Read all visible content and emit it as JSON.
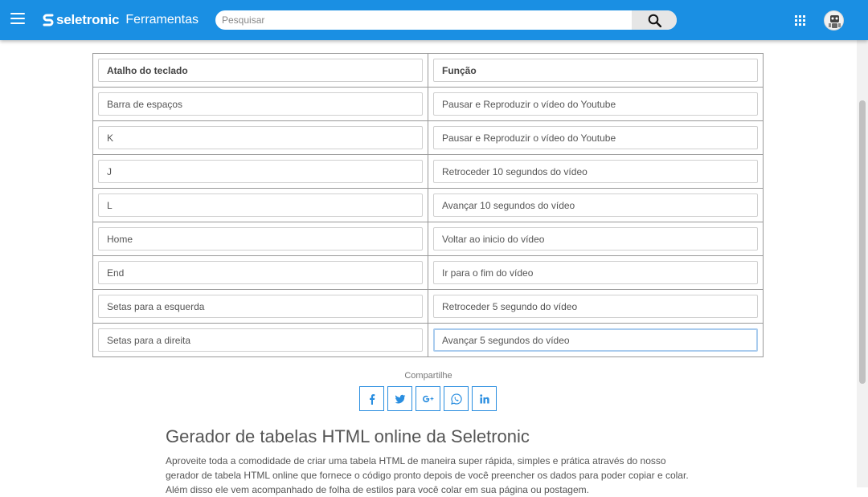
{
  "header": {
    "brand": "seletronic",
    "section": "Ferramentas",
    "search_placeholder": "Pesquisar",
    "accent": "#1a8fe3"
  },
  "table": {
    "headers": [
      "Atalho do teclado",
      "Função"
    ],
    "rows": [
      [
        "Barra de espaços",
        "Pausar e Reproduzir o vídeo do Youtube"
      ],
      [
        "K",
        "Pausar e Reproduzir o vídeo do Youtube"
      ],
      [
        "J",
        "Retroceder 10 segundos do vídeo"
      ],
      [
        "L",
        "Avançar 10 segundos do vídeo"
      ],
      [
        "Home",
        "Voltar ao inicio do vídeo"
      ],
      [
        "End",
        "Ir para o fim do vídeo"
      ],
      [
        "Setas para a esquerda",
        "Retroceder 5 segundo do vídeo"
      ],
      [
        "Setas para a direita",
        "Avançar 5 segundos do vídeo"
      ]
    ]
  },
  "share": {
    "label": "Compartilhe",
    "buttons": [
      "facebook-icon",
      "twitter-icon",
      "google-plus-icon",
      "whatsapp-icon",
      "linkedin-icon"
    ],
    "color": "#2a8ee0"
  },
  "article": {
    "title": "Gerador de tabelas HTML online da Seletronic",
    "body": "Aproveite toda a comodidade de criar uma tabela HTML de maneira super rápida, simples e prática através do nosso gerador de tabela HTML online que fornece o código pronto depois de você preencher os dados para poder copiar e colar. Além disso ele vem acompanhado de folha de estilos para você colar em sua página ou postagem."
  }
}
